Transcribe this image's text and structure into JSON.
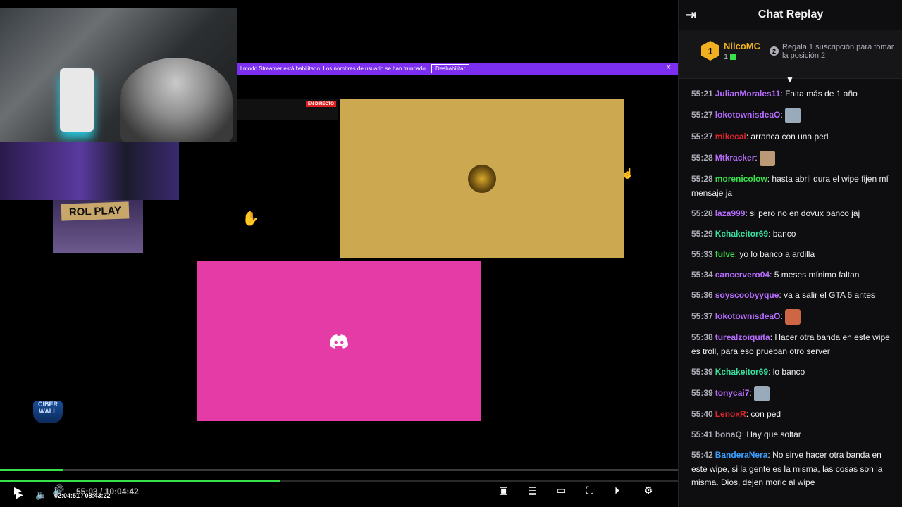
{
  "stream": {
    "banner_text": "l modo Streamer está habilitado. Los nombres de usuario se han truncado.",
    "banner_button": "Deshabilitar",
    "banner_close": "×",
    "rol_play_sign": "ROL PLAY",
    "mini_live_badge": "EN DIRECTO",
    "logo_text_top": "CIBER",
    "logo_text_bottom": "WALL",
    "inner_time": "55:03 / 10:04:42",
    "inner_progress": 0.092,
    "outer_time": "02:04:51 / 08:43:22",
    "outer_progress": 0.31,
    "tile_yellow_color": "#cca850",
    "tile_pink_color": "#e43ba6"
  },
  "chat": {
    "title": "Chat Replay",
    "leaderboard": {
      "rank1": "1",
      "name1": "NiicoMC",
      "sub1": "1",
      "rank2": "2",
      "text2": "Regala 1 suscripción para tomar la posición 2"
    },
    "messages": [
      {
        "time": "55:21",
        "user": "JulianMorales11",
        "color": "#b76cff",
        "text": "Falta más de 1 año"
      },
      {
        "time": "55:27",
        "user": "lokotownisdeaO",
        "color": "#b76cff",
        "text": ""
      },
      {
        "time": "55:27",
        "user": "mikecai",
        "color": "#e0242b",
        "text": "arranca con una ped"
      },
      {
        "time": "55:28",
        "user": "Mtkracker",
        "color": "#b76cff",
        "text": ""
      },
      {
        "time": "55:28",
        "user": "morenicolow",
        "color": "#38e04a",
        "text": "hasta abril dura el wipe fijen mí mensaje ja"
      },
      {
        "time": "55:28",
        "user": "laza999",
        "color": "#b76cff",
        "text": "si pero no en dovux banco jaj"
      },
      {
        "time": "55:29",
        "user": "Kchakeitor69",
        "color": "#38e0a0",
        "text": "banco"
      },
      {
        "time": "55:33",
        "user": "fulve",
        "color": "#38e04a",
        "text": "yo lo banco a ardilla"
      },
      {
        "time": "55:34",
        "user": "cancervero04",
        "color": "#b76cff",
        "text": "5 meses mínimo faltan"
      },
      {
        "time": "55:36",
        "user": "soyscoobyyque",
        "color": "#b76cff",
        "text": "va a salir el GTA 6 antes"
      },
      {
        "time": "55:37",
        "user": "lokotownisdeaO",
        "color": "#b76cff",
        "text": ""
      },
      {
        "time": "55:38",
        "user": "turealzoiquita",
        "color": "#b76cff",
        "text": "Hacer otra banda en este wipe es troll, para eso prueban otro server"
      },
      {
        "time": "55:39",
        "user": "Kchakeitor69",
        "color": "#38e0a0",
        "text": "lo banco"
      },
      {
        "time": "55:39",
        "user": "tonycai7",
        "color": "#b76cff",
        "text": ""
      },
      {
        "time": "55:40",
        "user": "LenoxR",
        "color": "#e0242b",
        "text": "con ped"
      },
      {
        "time": "55:41",
        "user": "bonaQ",
        "color": "#adadb8",
        "text": "Hay que soltar"
      },
      {
        "time": "55:42",
        "user": "BanderaNera",
        "color": "#3aa0ff",
        "text": "No sirve hacer otra banda en este wipe, si la gente es la misma, las cosas son la misma. Dios, dejen moric al wipe"
      }
    ]
  }
}
